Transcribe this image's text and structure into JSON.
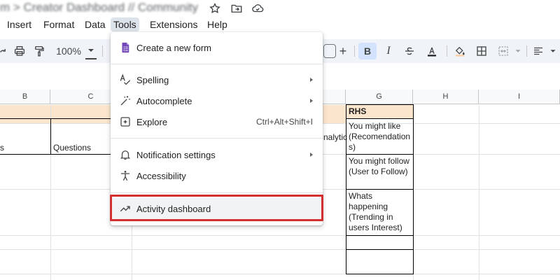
{
  "document": {
    "title": "m > Creator Dashboard // Community"
  },
  "title_icons": [
    "star-icon",
    "move-folder-icon",
    "cloud-status-icon"
  ],
  "menubar": {
    "items": [
      {
        "label": "Insert"
      },
      {
        "label": "Format"
      },
      {
        "label": "Data"
      },
      {
        "label": "Tools"
      },
      {
        "label": "Extensions"
      },
      {
        "label": "Help"
      }
    ],
    "active": "Tools"
  },
  "toolbar": {
    "zoom": "100%",
    "bold": "B",
    "italic": "I",
    "add": "+"
  },
  "columns": [
    {
      "label": "B"
    },
    {
      "label": "C"
    },
    {
      "label": "G"
    },
    {
      "label": "H"
    },
    {
      "label": "I"
    }
  ],
  "cells": {
    "b_partial": "s",
    "c_questions": "Questions",
    "f_partial": "nalytic",
    "g_rhs": "RHS",
    "g_row2": "You might like (Recomendations)",
    "g_row3": "You might follow (User to Follow)",
    "g_row4": "Whats happening (Trending in users Interest)"
  },
  "dropdown": {
    "create_form": "Create a new form",
    "spelling": "Spelling",
    "autocomplete": "Autocomplete",
    "explore": "Explore",
    "explore_shortcut": "Ctrl+Alt+Shift+I",
    "notification_settings": "Notification settings",
    "accessibility": "Accessibility",
    "activity_dashboard": "Activity dashboard"
  },
  "colors": {
    "accent": "#d3e3fd",
    "toolbar_bg": "#f0f4f9",
    "highlight_box": "#d32f2f",
    "header_band": "#fce5cd",
    "forms_purple": "#7248b9"
  }
}
